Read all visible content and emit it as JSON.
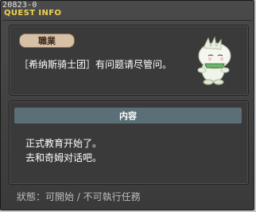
{
  "window": {
    "id_code": "20823-0",
    "title": "QUEST INFO"
  },
  "job": {
    "label": "職業"
  },
  "npc": {
    "line": "［希纳斯骑士团］有问题请尽管问。",
    "icon": "npc-ghost-icon"
  },
  "content": {
    "header": "内容",
    "lines": [
      "正式教育开始了。",
      "去和奇姆对话吧。"
    ]
  },
  "status": {
    "text": "狀態：可開始 / 不可執行任務"
  },
  "colors": {
    "title": "#f2d34b",
    "job_tag_bg": "#d7c1a6",
    "header_bg": "#5a6f78"
  }
}
